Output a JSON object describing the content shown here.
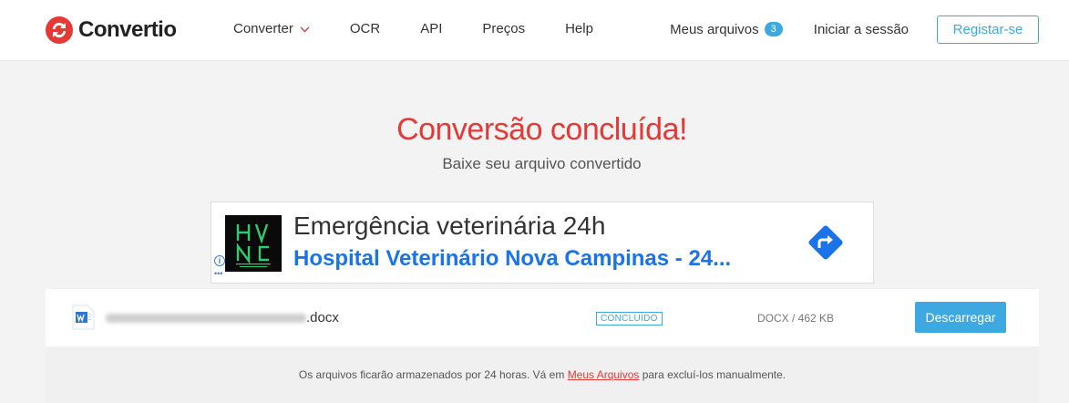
{
  "header": {
    "logo_text": "Convertio",
    "nav": [
      {
        "label": "Converter"
      },
      {
        "label": "OCR"
      },
      {
        "label": "API"
      },
      {
        "label": "Preços"
      },
      {
        "label": "Help"
      }
    ],
    "my_files_label": "Meus arquivos",
    "my_files_count": "3",
    "login_label": "Iniciar a sessão",
    "register_label": "Registar-se"
  },
  "hero": {
    "title": "Conversão concluída!",
    "subtitle": "Baixe seu arquivo convertido"
  },
  "ad": {
    "headline": "Emergência veterinária 24h",
    "subline": "Hospital Veterinário Nova Campinas - 24...",
    "info_glyph": "i",
    "dots": "•••",
    "colors": {
      "link": "#1a73e8",
      "arrow": "#1a73e8"
    },
    "logo_icon": "hvnc-logo",
    "arrow_icon": "directions-arrow-icon"
  },
  "file": {
    "name_suffix": ".docx",
    "status": "CONCLUÍDO",
    "size": "DOCX / 462 KB",
    "download_label": "Descarregar",
    "icon": "word-file-icon"
  },
  "info": {
    "before": "Os arquivos ficarão armazenados por 24 horas. Vá em ",
    "link": "Meus Arquivos",
    "after": " para excluí-los manualmente."
  },
  "colors": {
    "accent": "#3da9e0",
    "brand_red": "#e53935"
  }
}
